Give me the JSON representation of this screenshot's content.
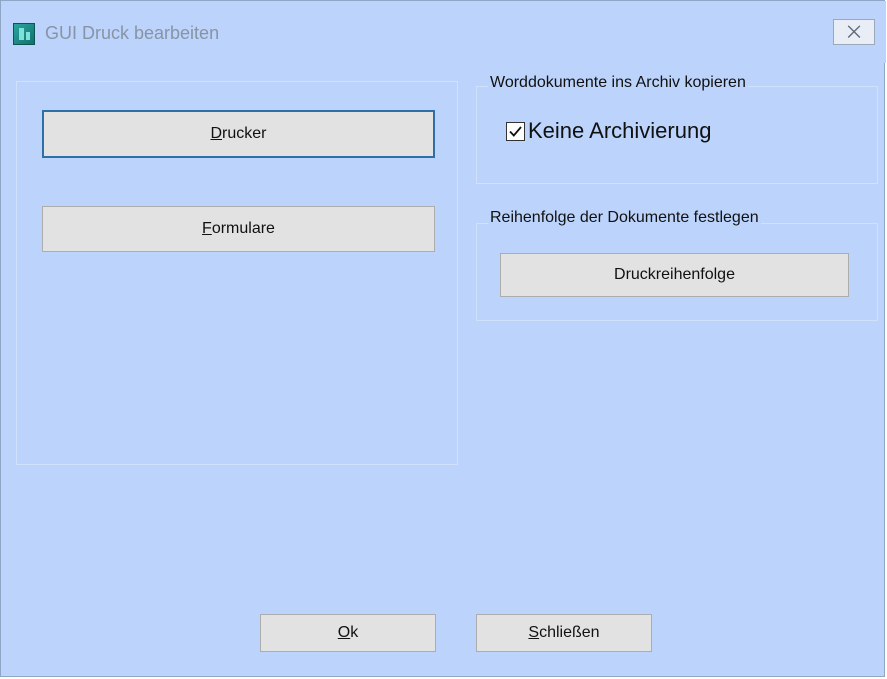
{
  "window": {
    "title": "GUI Druck bearbeiten",
    "close_glyph": "⨉"
  },
  "left_group": {
    "drucker_button": {
      "mnemonic": "D",
      "rest": "rucker"
    },
    "formulare_button": {
      "mnemonic": "F",
      "rest": "ormulare"
    }
  },
  "archive_group": {
    "label": "Worddokumente ins Archiv kopieren",
    "checkbox_label": "Keine Archivierung",
    "checked": true
  },
  "order_group": {
    "label": "Reihenfolge der Dokumente festlegen",
    "button_label": "Druckreihenfolge"
  },
  "footer": {
    "ok_button": {
      "mnemonic": "O",
      "rest": "k"
    },
    "close_button": {
      "mnemonic": "S",
      "rest": "chließen"
    }
  },
  "icons": {
    "app": "app-icon",
    "close": "close-icon",
    "check": "checkmark-icon"
  },
  "colors": {
    "window_background": "#bcd3fb",
    "button_background": "#e2e2e2",
    "focus_border": "#2f6fa8"
  }
}
